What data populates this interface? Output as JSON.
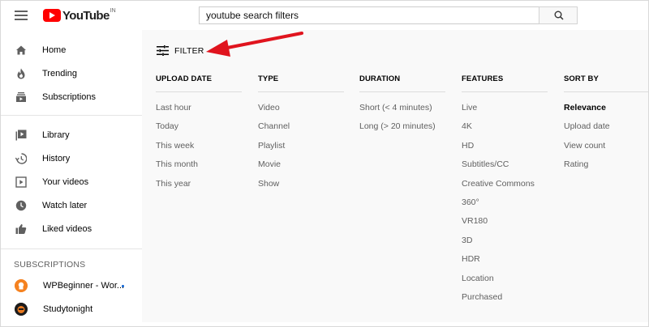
{
  "header": {
    "logo_text": "YouTube",
    "logo_country": "IN",
    "search_value": "youtube search filters",
    "icons": [
      "hamburger-menu-icon",
      "youtube-logo-icon",
      "search-icon"
    ]
  },
  "sidebar": {
    "items": [
      {
        "label": "Home",
        "icon": "home-icon"
      },
      {
        "label": "Trending",
        "icon": "flame-icon"
      },
      {
        "label": "Subscriptions",
        "icon": "subscriptions-icon"
      },
      {
        "label": "Library",
        "icon": "library-icon"
      },
      {
        "label": "History",
        "icon": "history-icon"
      },
      {
        "label": "Your videos",
        "icon": "your-videos-icon"
      },
      {
        "label": "Watch later",
        "icon": "clock-icon"
      },
      {
        "label": "Liked videos",
        "icon": "thumbs-up-icon"
      }
    ],
    "subscriptions_title": "SUBSCRIPTIONS",
    "subscriptions": [
      {
        "label": "WPBeginner - Wor...",
        "live": true
      },
      {
        "label": "Studytonight",
        "live": false
      }
    ]
  },
  "filter": {
    "toggle_label": "FILTER",
    "columns": [
      {
        "header": "UPLOAD DATE",
        "options": [
          "Last hour",
          "Today",
          "This week",
          "This month",
          "This year"
        ]
      },
      {
        "header": "TYPE",
        "options": [
          "Video",
          "Channel",
          "Playlist",
          "Movie",
          "Show"
        ]
      },
      {
        "header": "DURATION",
        "options": [
          "Short (< 4 minutes)",
          "Long (> 20 minutes)"
        ]
      },
      {
        "header": "FEATURES",
        "options": [
          "Live",
          "4K",
          "HD",
          "Subtitles/CC",
          "Creative Commons",
          "360°",
          "VR180",
          "3D",
          "HDR",
          "Location",
          "Purchased"
        ]
      },
      {
        "header": "SORT BY",
        "options": [
          "Relevance",
          "Upload date",
          "View count",
          "Rating"
        ],
        "selected": "Relevance"
      }
    ]
  },
  "colors": {
    "brand_red": "#ff0000",
    "annotation_arrow": "#e0141e",
    "panel_bg": "#f9f9f9",
    "muted_text": "#606060"
  }
}
